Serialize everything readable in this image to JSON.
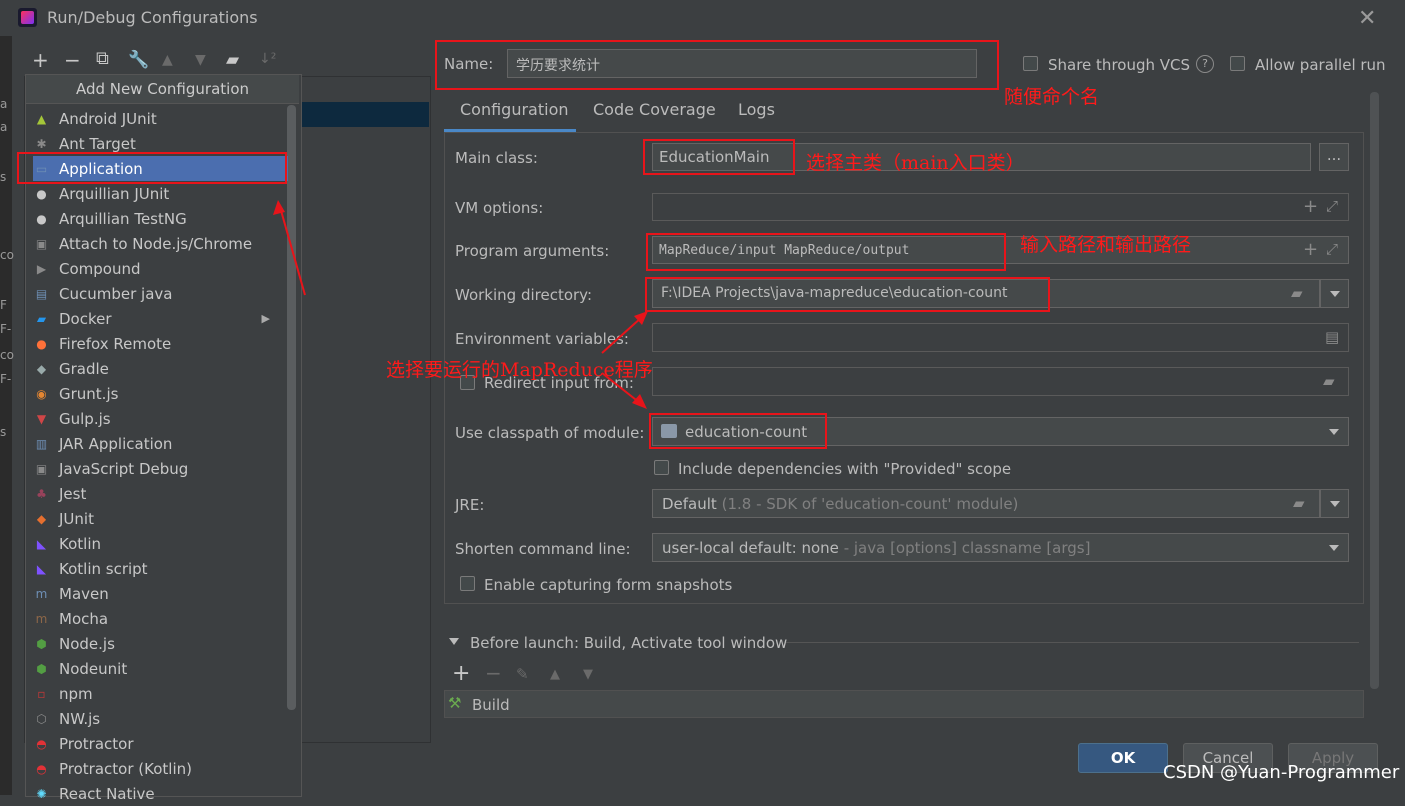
{
  "window": {
    "title": "Run/Debug Configurations"
  },
  "background_strip": [
    "a",
    "a",
    "s",
    "co",
    "F",
    "F-",
    "co",
    "F-",
    "s"
  ],
  "toolbar": {
    "add": "+",
    "remove": "−",
    "copy": "⧉",
    "edit": "🔧",
    "up": "▲",
    "down": "▼",
    "folder": "▰",
    "sort": "↓²"
  },
  "popup": {
    "title": "Add New Configuration",
    "items": [
      {
        "label": "Android JUnit",
        "icon": "android-icon",
        "color": "#a4c639",
        "glyph": "▲"
      },
      {
        "label": "Ant Target",
        "icon": "ant-icon",
        "color": "#8a8a8a",
        "glyph": "✱"
      },
      {
        "label": "Application",
        "icon": "application-icon",
        "color": "#6e8fb5",
        "glyph": "▭"
      },
      {
        "label": "Arquillian JUnit",
        "icon": "arquillian-icon",
        "color": "#c8c8c8",
        "glyph": "●"
      },
      {
        "label": "Arquillian TestNG",
        "icon": "arquillian-icon",
        "color": "#c8c8c8",
        "glyph": "●"
      },
      {
        "label": "Attach to Node.js/Chrome",
        "icon": "attach-nodejs-icon",
        "color": "#8a8a8a",
        "glyph": "▣"
      },
      {
        "label": "Compound",
        "icon": "compound-icon",
        "color": "#8a8a8a",
        "glyph": "▶"
      },
      {
        "label": "Cucumber java",
        "icon": "cucumber-icon",
        "color": "#6e8fb5",
        "glyph": "▤"
      },
      {
        "label": "Docker",
        "icon": "docker-icon",
        "color": "#2496ed",
        "glyph": "▰",
        "submenu": "▶"
      },
      {
        "label": "Firefox Remote",
        "icon": "firefox-icon",
        "color": "#ff7139",
        "glyph": "●"
      },
      {
        "label": "Gradle",
        "icon": "gradle-icon",
        "color": "#9aa",
        "glyph": "◆"
      },
      {
        "label": "Grunt.js",
        "icon": "grunt-icon",
        "color": "#e48632",
        "glyph": "◉"
      },
      {
        "label": "Gulp.js",
        "icon": "gulp-icon",
        "color": "#cf4647",
        "glyph": "▼"
      },
      {
        "label": "JAR Application",
        "icon": "jar-icon",
        "color": "#6e8fb5",
        "glyph": "▥"
      },
      {
        "label": "JavaScript Debug",
        "icon": "js-debug-icon",
        "color": "#8a8a8a",
        "glyph": "▣"
      },
      {
        "label": "Jest",
        "icon": "jest-icon",
        "color": "#99425b",
        "glyph": "♣"
      },
      {
        "label": "JUnit",
        "icon": "junit-icon",
        "color": "#e56f2f",
        "glyph": "◆"
      },
      {
        "label": "Kotlin",
        "icon": "kotlin-icon",
        "color": "#7f52ff",
        "glyph": "◣"
      },
      {
        "label": "Kotlin script",
        "icon": "kotlin-icon",
        "color": "#7f52ff",
        "glyph": "◣"
      },
      {
        "label": "Maven",
        "icon": "maven-icon",
        "color": "#6e8fb5",
        "glyph": "m"
      },
      {
        "label": "Mocha",
        "icon": "mocha-icon",
        "color": "#8d6748",
        "glyph": "m"
      },
      {
        "label": "Node.js",
        "icon": "nodejs-icon",
        "color": "#539e43",
        "glyph": "⬢"
      },
      {
        "label": "Nodeunit",
        "icon": "nodeunit-icon",
        "color": "#539e43",
        "glyph": "⬢"
      },
      {
        "label": "npm",
        "icon": "npm-icon",
        "color": "#cb3837",
        "glyph": "▫"
      },
      {
        "label": "NW.js",
        "icon": "nwjs-icon",
        "color": "#8a8a8a",
        "glyph": "⬡"
      },
      {
        "label": "Protractor",
        "icon": "protractor-icon",
        "color": "#e23237",
        "glyph": "◓"
      },
      {
        "label": "Protractor (Kotlin)",
        "icon": "protractor-icon",
        "color": "#e23237",
        "glyph": "◓"
      },
      {
        "label": "React Native",
        "icon": "react-icon",
        "color": "#61dafb",
        "glyph": "✺"
      }
    ]
  },
  "form": {
    "name_label": "Name:",
    "name_value": "学历要求统计",
    "share_vcs": "Share through VCS",
    "help": "?",
    "allow_parallel": "Allow parallel run",
    "tabs": [
      "Configuration",
      "Code Coverage",
      "Logs"
    ],
    "main_class_label": "Main class:",
    "main_class_value": "EducationMain",
    "browse": "...",
    "vm_options_label": "VM options:",
    "program_args_label": "Program arguments:",
    "program_args_value": "MapReduce/input MapReduce/output",
    "working_dir_label": "Working directory:",
    "working_dir_value": "F:\\IDEA Projects\\java-mapreduce\\education-count",
    "env_vars_label": "Environment variables:",
    "redirect_label": "Redirect input from:",
    "classpath_label": "Use classpath of module:",
    "classpath_value": "education-count",
    "include_deps": "Include dependencies with \"Provided\" scope",
    "jre_label": "JRE:",
    "jre_value": "Default",
    "jre_hint": "(1.8 - SDK of 'education-count' module)",
    "shorten_label": "Shorten command line:",
    "shorten_value": "user-local default: none",
    "shorten_hint": " - java [options] classname [args]",
    "capture_label": "Enable capturing form snapshots",
    "before_launch": "Before launch: Build, Activate tool window",
    "build_item": "Build",
    "plus": "+",
    "minus": "−",
    "expand": "⤢"
  },
  "annotations": {
    "name": "随便命个名",
    "main_class": "选择主类（main入口类）",
    "args": "输入路径和输出路径",
    "module": "选择要运行的MapReduce程序"
  },
  "buttons": {
    "ok": "OK",
    "cancel": "Cancel",
    "apply": "Apply"
  },
  "watermark": "CSDN @Yuan-Programmer"
}
